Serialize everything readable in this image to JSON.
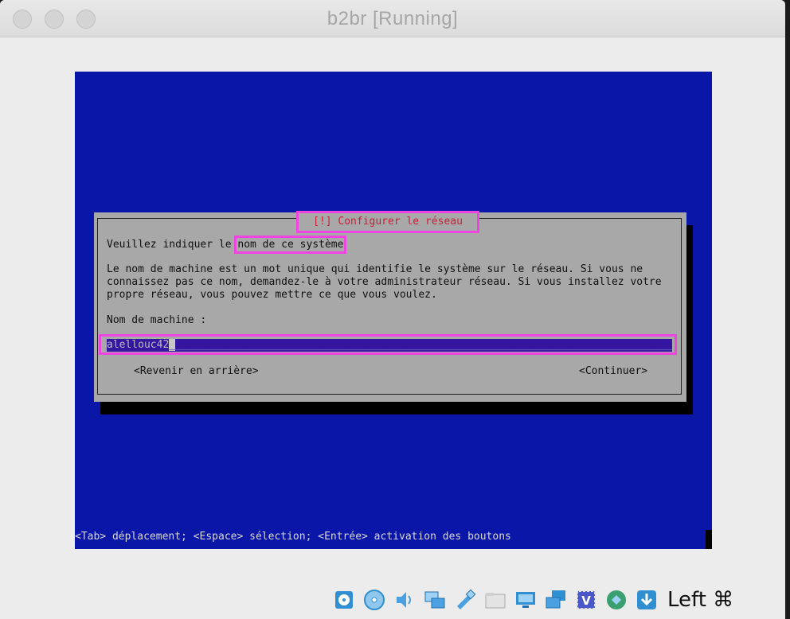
{
  "window": {
    "title": "b2br [Running]"
  },
  "dialog": {
    "title": "[!] Configurer le réseau",
    "prompt_prefix": "Veuillez indiquer le ",
    "prompt_highlight": "nom de ce système",
    "description_lines": [
      "Le nom de machine est un mot unique qui identifie le système sur le réseau. Si vous ne",
      "connaissez pas ce nom, demandez-le à votre administrateur réseau. Si vous installez votre",
      "propre réseau, vous pouvez mettre ce que vous voulez."
    ],
    "field_label": "Nom de machine :",
    "field_value": "alellouc42",
    "back_button": "<Revenir en arrière>",
    "continue_button": "<Continuer>"
  },
  "statusbar": {
    "text": "<Tab> déplacement; <Espace> sélection; <Entrée> activation des boutons"
  },
  "tray": {
    "icons": [
      "hard-disk-icon",
      "optical-drive-icon",
      "audio-icon",
      "network-icon",
      "usb-icon",
      "shared-folder-icon",
      "display-icon",
      "screen-capture-icon",
      "virtualbox-icon",
      "mouse-integration-icon",
      "download-icon"
    ],
    "host_key": "Left ⌘"
  }
}
